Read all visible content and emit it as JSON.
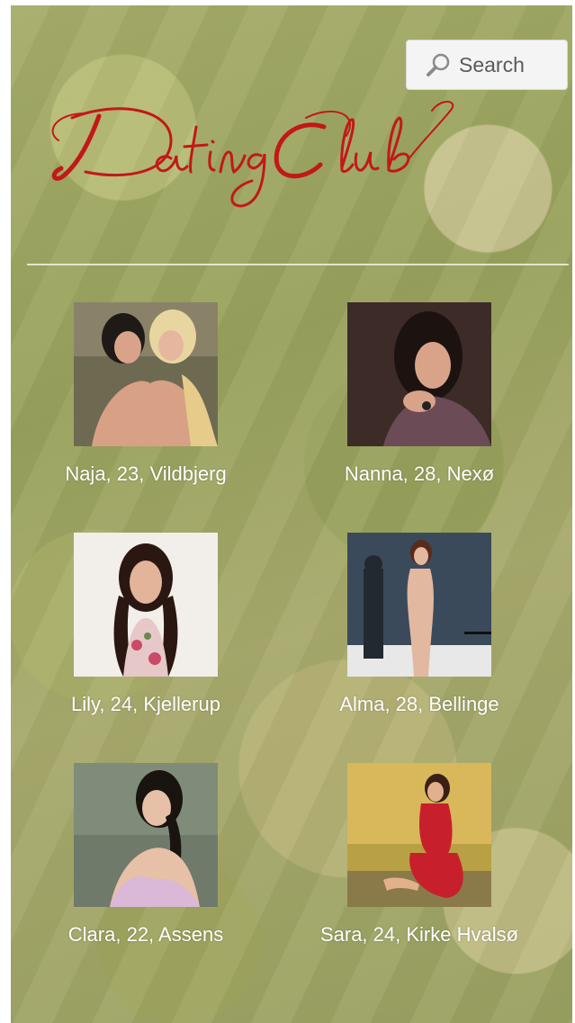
{
  "header": {
    "logo_text": "DatingClub",
    "logo_color": "#c21818",
    "search": {
      "placeholder": "Search",
      "icon": "magnifier-icon"
    }
  },
  "profiles": [
    {
      "caption": "Naja, 23, Vildbjerg"
    },
    {
      "caption": "Nanna, 28, Nexø"
    },
    {
      "caption": "Lily, 24, Kjellerup"
    },
    {
      "caption": "Alma, 28, Bellinge"
    },
    {
      "caption": "Clara, 22, Assens"
    },
    {
      "caption": "Sara, 24, Kirke Hvalsø"
    }
  ]
}
